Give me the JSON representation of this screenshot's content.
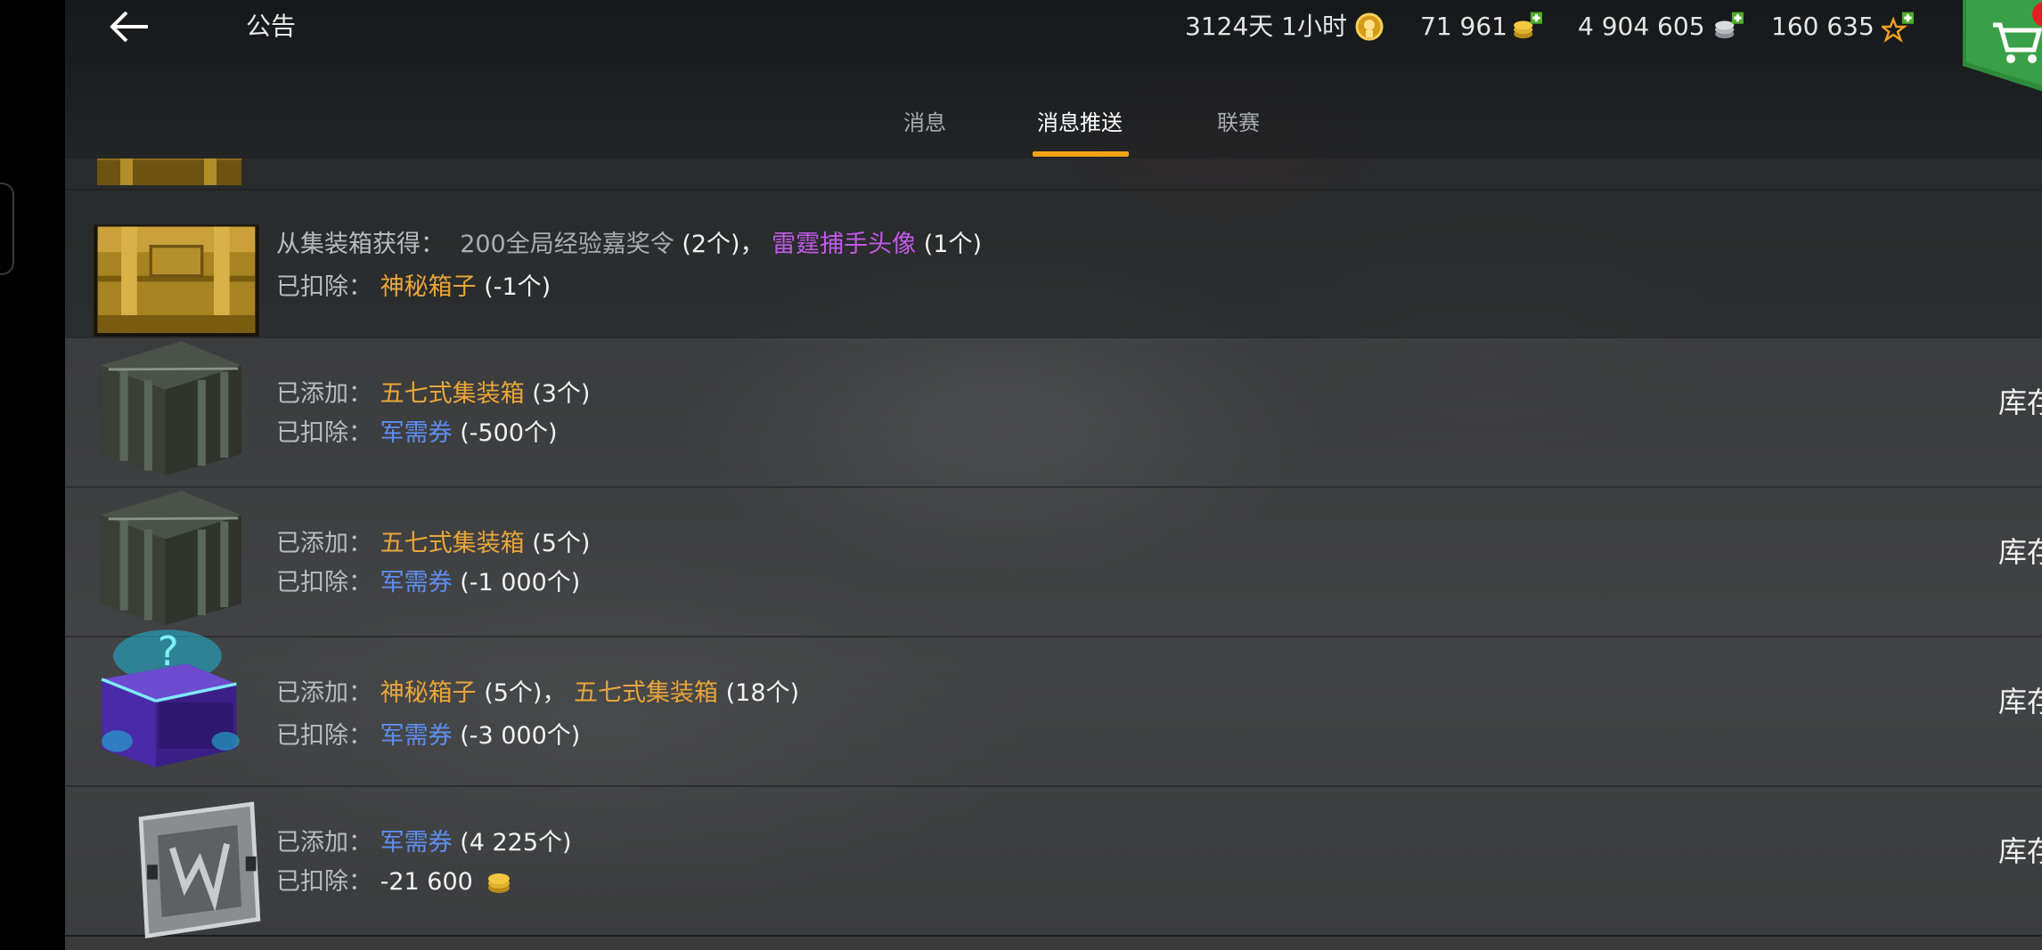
{
  "header": {
    "title": "公告",
    "resources": {
      "time": "3124天 1小时",
      "gold": "71 961",
      "silver": "4 904 605",
      "free_xp": "160 635"
    }
  },
  "tabs": [
    {
      "label": "消息",
      "active": false
    },
    {
      "label": "消息推送",
      "active": true
    },
    {
      "label": "联赛",
      "active": false
    }
  ],
  "messages": [
    {
      "line1": {
        "prefix": "从集装箱获得：",
        "items": [
          {
            "name": "200全局经验嘉奖令",
            "qty": "(2个)",
            "color": "grey",
            "sep": "，"
          },
          {
            "name": "雷霆捕手头像",
            "qty": "(1个)",
            "color": "purple"
          }
        ]
      },
      "line2": {
        "prefix": "已扣除：",
        "items": [
          {
            "name": "神秘箱子",
            "qty": "(-1个)",
            "color": "gold"
          }
        ]
      },
      "right": "",
      "icon": "gold-crate-icon"
    },
    {
      "line1": {
        "prefix": "已添加：",
        "items": [
          {
            "name": "五七式集装箱",
            "qty": "(3个)",
            "color": "gold"
          }
        ]
      },
      "line2": {
        "prefix": "已扣除：",
        "items": [
          {
            "name": "军需券",
            "qty": "(-500个)",
            "color": "blue"
          }
        ]
      },
      "right": "库存",
      "icon": "military-crate-icon"
    },
    {
      "line1": {
        "prefix": "已添加：",
        "items": [
          {
            "name": "五七式集装箱",
            "qty": "(5个)",
            "color": "gold"
          }
        ]
      },
      "line2": {
        "prefix": "已扣除：",
        "items": [
          {
            "name": "军需券",
            "qty": "(-1 000个)",
            "color": "blue"
          }
        ]
      },
      "right": "库存",
      "icon": "military-crate-icon"
    },
    {
      "line1": {
        "prefix": "已添加：",
        "items": [
          {
            "name": "神秘箱子",
            "qty": "(5个)",
            "color": "gold",
            "sep": "，"
          },
          {
            "name": "五七式集装箱",
            "qty": "(18个)",
            "color": "gold"
          }
        ]
      },
      "line2": {
        "prefix": "已扣除：",
        "items": [
          {
            "name": "军需券",
            "qty": "(-3 000个)",
            "color": "blue"
          }
        ]
      },
      "right": "库存",
      "icon": "mystery-box-icon"
    },
    {
      "line1": {
        "prefix": "已添加：",
        "items": [
          {
            "name": "军需券",
            "qty": "(4 225个)",
            "color": "blue"
          }
        ]
      },
      "line2": {
        "prefix": "已扣除：",
        "items": [
          {
            "name": "",
            "qty": "-21 600",
            "color": "white"
          }
        ]
      },
      "right": "库存",
      "icon": "voucher-icon"
    }
  ],
  "colors": {
    "tab_underline": "#f0a318",
    "gold_text": "#e9a63a",
    "blue_text": "#5f8ef0",
    "purple_text": "#c05ae8",
    "shop_green": "#2e8a3a",
    "badge_red": "#e02020"
  }
}
